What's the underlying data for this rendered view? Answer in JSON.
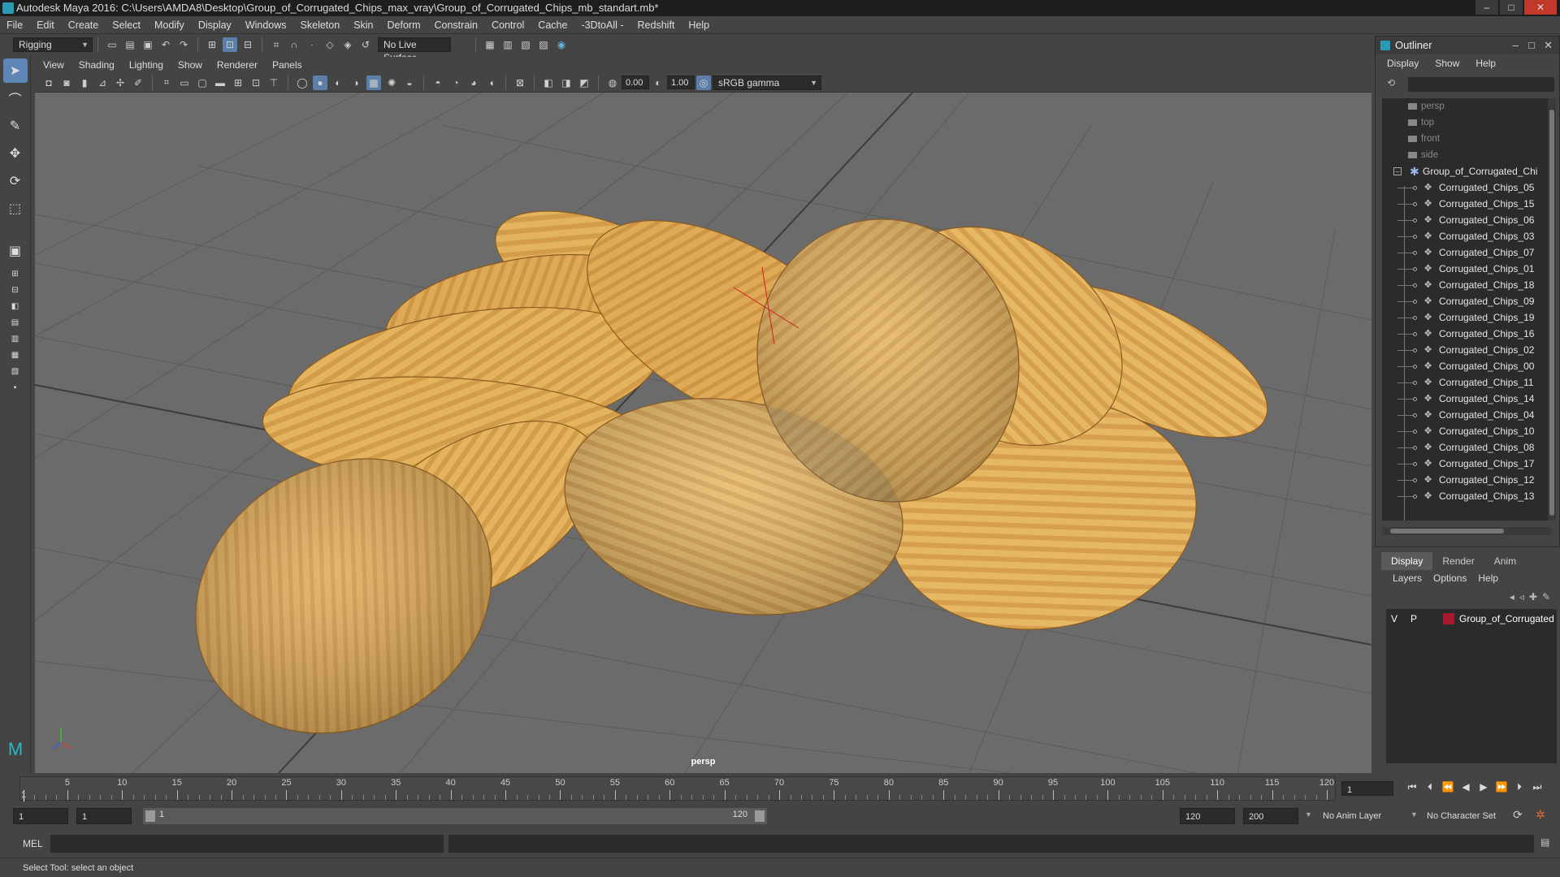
{
  "window": {
    "title": "Autodesk Maya 2016: C:\\Users\\AMDA8\\Desktop\\Group_of_Corrugated_Chips_max_vray\\Group_of_Corrugated_Chips_mb_standart.mb*"
  },
  "menubar": [
    "File",
    "Edit",
    "Create",
    "Select",
    "Modify",
    "Display",
    "Windows",
    "Skeleton",
    "Skin",
    "Deform",
    "Constrain",
    "Control",
    "Cache",
    "-3DtoAll -",
    "Redshift",
    "Help"
  ],
  "statusline": {
    "menuset": "Rigging",
    "live_surface": "No Live Surface"
  },
  "viewport": {
    "menus": [
      "View",
      "Shading",
      "Lighting",
      "Show",
      "Renderer",
      "Panels"
    ],
    "exposure": "0.00",
    "gamma": "1.00",
    "colorspace": "sRGB gamma",
    "camera": "persp"
  },
  "outliner": {
    "title": "Outliner",
    "menus": [
      "Display",
      "Show",
      "Help"
    ],
    "cameras": [
      "persp",
      "top",
      "front",
      "side"
    ],
    "group": "Group_of_Corrugated_Chi",
    "children": [
      "Corrugated_Chips_05",
      "Corrugated_Chips_15",
      "Corrugated_Chips_06",
      "Corrugated_Chips_03",
      "Corrugated_Chips_07",
      "Corrugated_Chips_01",
      "Corrugated_Chips_18",
      "Corrugated_Chips_09",
      "Corrugated_Chips_19",
      "Corrugated_Chips_16",
      "Corrugated_Chips_02",
      "Corrugated_Chips_00",
      "Corrugated_Chips_11",
      "Corrugated_Chips_14",
      "Corrugated_Chips_04",
      "Corrugated_Chips_10",
      "Corrugated_Chips_08",
      "Corrugated_Chips_17",
      "Corrugated_Chips_12",
      "Corrugated_Chips_13"
    ]
  },
  "layers": {
    "tabs": [
      "Display",
      "Render",
      "Anim"
    ],
    "menus": [
      "Layers",
      "Options",
      "Help"
    ],
    "row": {
      "v": "V",
      "p": "P",
      "name": "Group_of_Corrugated",
      "color": "#a8182c"
    }
  },
  "timeline": {
    "ticks": [
      "5",
      "10",
      "15",
      "20",
      "25",
      "30",
      "35",
      "40",
      "45",
      "50",
      "55",
      "60",
      "65",
      "70",
      "75",
      "80",
      "85",
      "90",
      "95",
      "100",
      "105",
      "110",
      "115",
      "120"
    ],
    "start_marker": "1",
    "current_frame": "1"
  },
  "range": {
    "start": "1",
    "playback_start": "1",
    "slider_start": "1",
    "slider_end": "120",
    "playback_end": "120",
    "end": "200",
    "anim_layer": "No Anim Layer",
    "character_set": "No Character Set"
  },
  "cmdline": {
    "label": "MEL"
  },
  "helpline": {
    "text": "Select Tool: select an object"
  }
}
